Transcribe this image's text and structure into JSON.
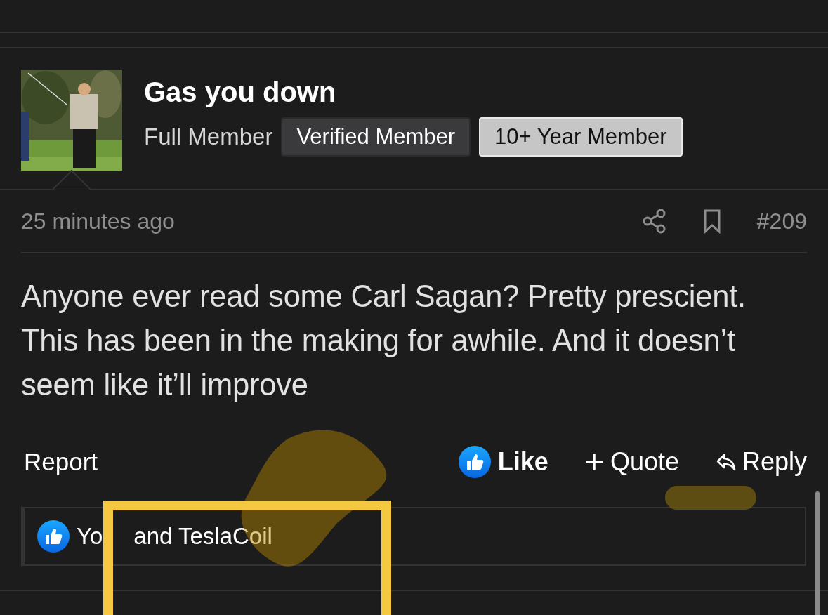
{
  "post": {
    "author": "Gas you down",
    "member_title": "Full Member",
    "badges": [
      {
        "label": "Verified Member",
        "kind": "dark"
      },
      {
        "label": "10+ Year Member",
        "kind": "light"
      }
    ],
    "time": "25 minutes ago",
    "number": "#209",
    "body": "Anyone ever read some Carl Sagan? Pretty prescient. This has been in the making for awhile. And it doesn’t seem like it’ll improve",
    "actions": {
      "report": "Report",
      "like": "Like",
      "quote": "Quote",
      "reply": "Reply"
    },
    "reactions": [
      "Yo",
      "and TeslaCoil"
    ]
  }
}
